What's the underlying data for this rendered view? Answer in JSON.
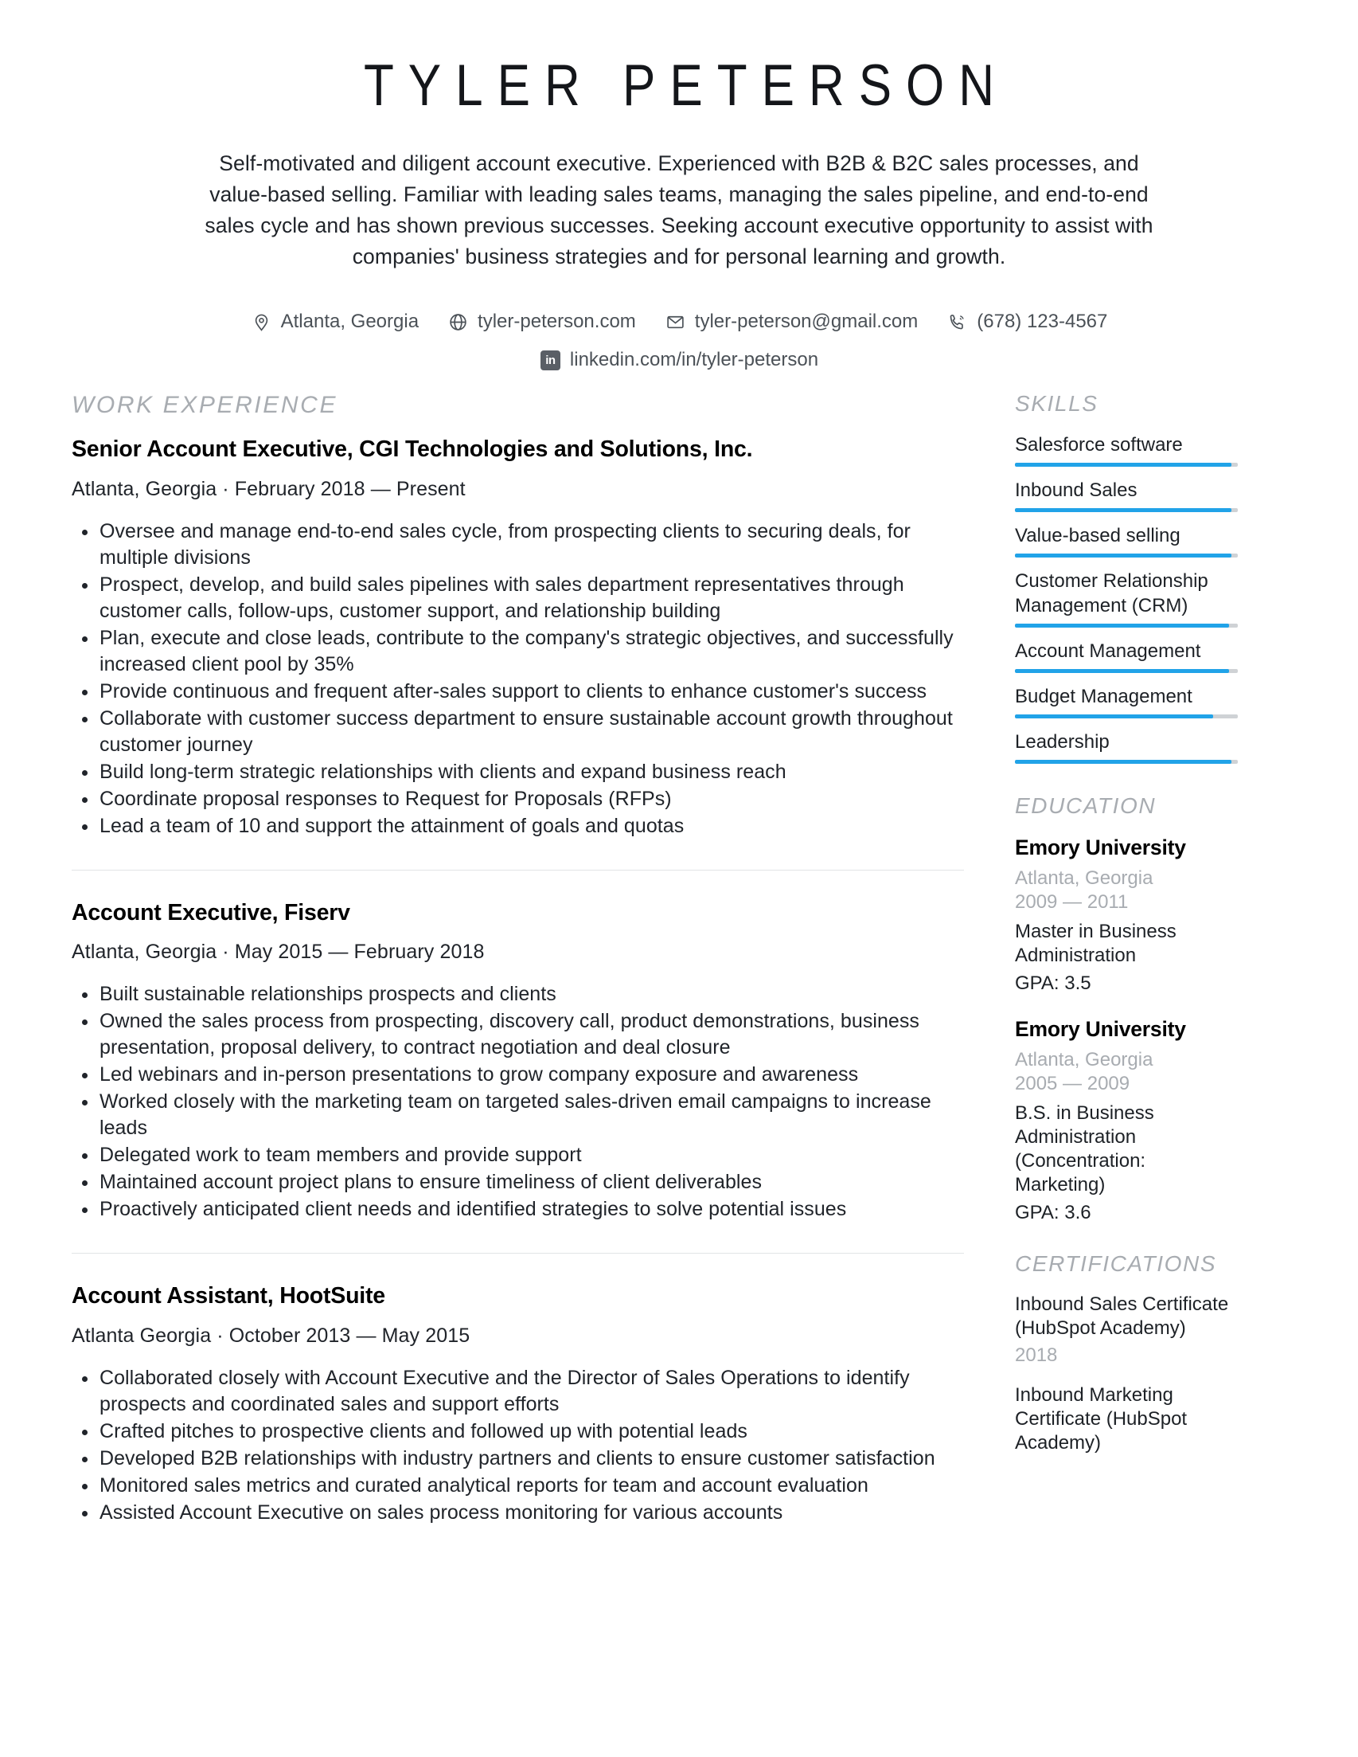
{
  "header": {
    "name": "TYLER PETERSON",
    "summary": "Self-motivated and diligent account executive. Experienced with B2B & B2C sales processes, and value-based selling. Familiar with leading sales teams, managing the sales pipeline, and end-to-end sales cycle and has shown previous successes. Seeking account executive opportunity to assist with companies' business strategies and for personal learning and growth.",
    "contacts": [
      {
        "icon": "location-pin-icon",
        "text": "Atlanta, Georgia"
      },
      {
        "icon": "globe-icon",
        "text": "tyler-peterson.com"
      },
      {
        "icon": "envelope-icon",
        "text": "tyler-peterson@gmail.com"
      },
      {
        "icon": "phone-icon",
        "text": "(678) 123-4567"
      }
    ],
    "linkedin": {
      "icon": "linkedin-icon",
      "badge": "in",
      "text": "linkedin.com/in/tyler-peterson"
    }
  },
  "sections": {
    "work_experience_title": "WORK EXPERIENCE",
    "skills_title": "SKILLS",
    "education_title": "EDUCATION",
    "certifications_title": "CERTIFICATIONS"
  },
  "jobs": [
    {
      "title": "Senior Account Executive, CGI Technologies and Solutions, Inc.",
      "meta": "Atlanta, Georgia · February 2018 — Present",
      "bullets": [
        "Oversee and manage end-to-end sales cycle, from prospecting clients to securing deals, for multiple divisions",
        "Prospect, develop, and build sales pipelines with sales department representatives through customer calls, follow-ups, customer support, and relationship building",
        "Plan, execute and close leads, contribute to the company's strategic objectives, and successfully increased client pool by 35%",
        "Provide continuous and frequent after-sales support to clients to enhance customer's success",
        "Collaborate with customer success department to ensure sustainable account growth throughout customer journey",
        "Build long-term strategic relationships with clients and expand business reach",
        "Coordinate proposal responses to Request for Proposals (RFPs)",
        "Lead a team of 10 and support the attainment of goals and quotas"
      ]
    },
    {
      "title": "Account Executive, Fiserv",
      "meta": "Atlanta, Georgia · May 2015 — February 2018",
      "bullets": [
        "Built sustainable relationships prospects and clients",
        "Owned the sales process from prospecting, discovery call, product demonstrations, business presentation, proposal delivery, to contract negotiation and deal closure",
        "Led webinars and in-person presentations to grow company exposure and awareness",
        "Worked closely with the marketing team on targeted sales-driven email campaigns to increase leads",
        "Delegated work to team members and provide support",
        "Maintained account project plans to ensure timeliness of client deliverables",
        "Proactively anticipated client needs and identified strategies to solve potential issues"
      ]
    },
    {
      "title": "Account Assistant, HootSuite",
      "meta": "Atlanta Georgia · October 2013 — May 2015",
      "bullets": [
        "Collaborated closely with Account Executive and the Director of Sales Operations to identify prospects and coordinated sales and support efforts",
        "Crafted pitches to prospective clients and followed up with potential leads",
        "Developed B2B relationships with industry partners and clients to ensure customer satisfaction",
        "Monitored sales metrics and curated analytical reports for team and account evaluation",
        "Assisted Account Executive on sales process monitoring for various accounts"
      ]
    }
  ],
  "skills": [
    {
      "label": "Salesforce software",
      "level": 97
    },
    {
      "label": "Inbound Sales",
      "level": 97
    },
    {
      "label": "Value-based selling",
      "level": 97
    },
    {
      "label": "Customer Relationship Management (CRM)",
      "level": 96
    },
    {
      "label": "Account Management",
      "level": 96
    },
    {
      "label": "Budget Management",
      "level": 89
    },
    {
      "label": "Leadership",
      "level": 97
    }
  ],
  "education": [
    {
      "school": "Emory University",
      "location": "Atlanta, Georgia",
      "years": "2009 — 2011",
      "degree": "Master in Business Administration",
      "gpa": "GPA: 3.5"
    },
    {
      "school": "Emory University",
      "location": "Atlanta, Georgia",
      "years": "2005 — 2009",
      "degree": "B.S. in Business Administration (Concentration: Marketing)",
      "gpa": "GPA: 3.6"
    }
  ],
  "certifications": [
    {
      "name": "Inbound Sales Certificate (HubSpot Academy)",
      "year": "2018"
    },
    {
      "name": "Inbound Marketing Certificate (HubSpot Academy)",
      "year": ""
    }
  ],
  "colors": {
    "accent": "#21a3e8",
    "track": "#cfd2d5",
    "muted": "#a8acb1",
    "text": "#20242a"
  }
}
